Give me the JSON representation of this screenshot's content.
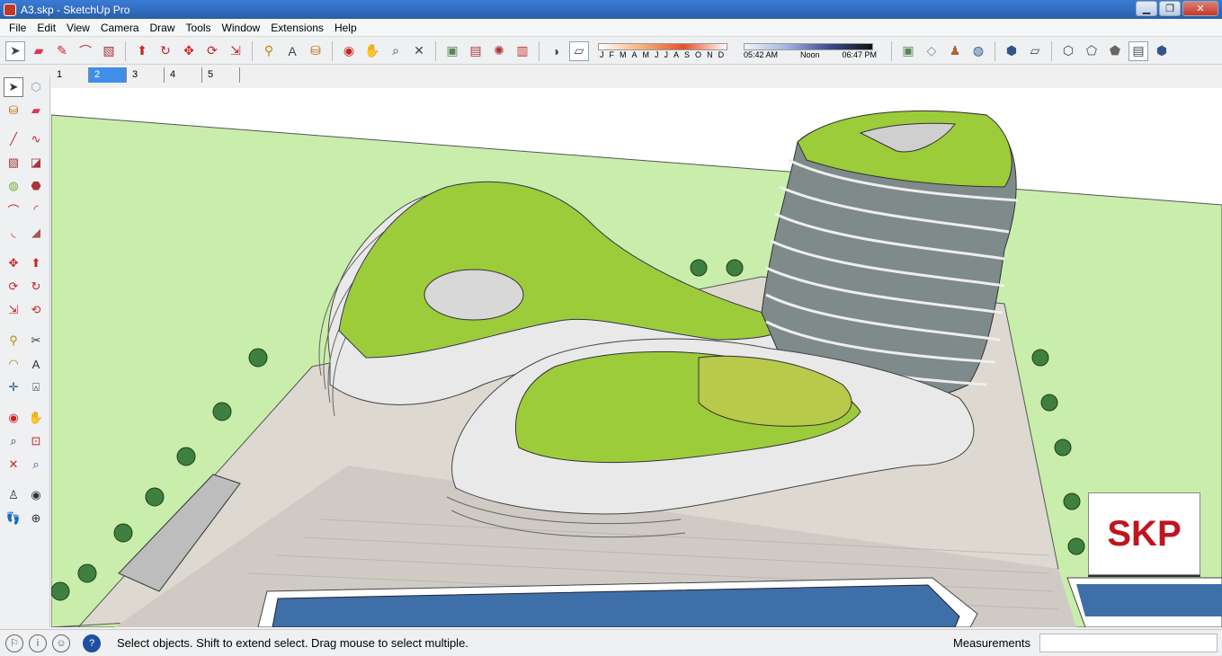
{
  "window": {
    "title": "A3.skp - SketchUp Pro",
    "minimize": "▁",
    "maximize": "❐",
    "close": "✕"
  },
  "menu": [
    "File",
    "Edit",
    "View",
    "Camera",
    "Draw",
    "Tools",
    "Window",
    "Extensions",
    "Help"
  ],
  "shadow": {
    "months": [
      "J",
      "F",
      "M",
      "A",
      "M",
      "J",
      "J",
      "A",
      "S",
      "O",
      "N",
      "D"
    ],
    "time_start": "05:42 AM",
    "time_mid": "Noon",
    "time_end": "06:47 PM"
  },
  "scene_tabs": [
    "1",
    "2",
    "3",
    "4",
    "5"
  ],
  "active_scene": "2",
  "status": {
    "message": "Select objects. Shift to extend select. Drag mouse to select multiple.",
    "measurements_label": "Measurements",
    "measurements_value": ""
  },
  "logo_text": "SKP",
  "colors": {
    "accent": "#3f8ee8",
    "roof_green": "#9ccc3a",
    "ground": "#c8efa8",
    "water": "#3f6fa8",
    "logo_red": "#c0141f"
  },
  "toolbar_icons": [
    "select-icon",
    "eraser-icon",
    "pencil-icon",
    "arc-icon",
    "rectangle-icon",
    "push-pull-icon",
    "follow-me-icon",
    "move-icon",
    "rotate-icon",
    "scale-icon",
    "tape-measure-icon",
    "text-icon",
    "paint-bucket-icon",
    "orbit-icon",
    "pan-icon",
    "zoom-icon",
    "zoom-extents-icon",
    "warehouse-icon",
    "share-model-icon",
    "extension-warehouse-icon",
    "layout-icon",
    "shadow-toggle-icon",
    "fog-icon"
  ],
  "style_icons": [
    "warehouse-model-icon",
    "sandbox-icon",
    "person-icon",
    "geo-location-icon",
    "iso-view-icon",
    "top-view-icon",
    "front-view-icon",
    "right-view-icon",
    "back-view-icon",
    "left-view-icon",
    "wireframe-icon",
    "hidden-line-icon",
    "shaded-icon",
    "textured-icon"
  ]
}
